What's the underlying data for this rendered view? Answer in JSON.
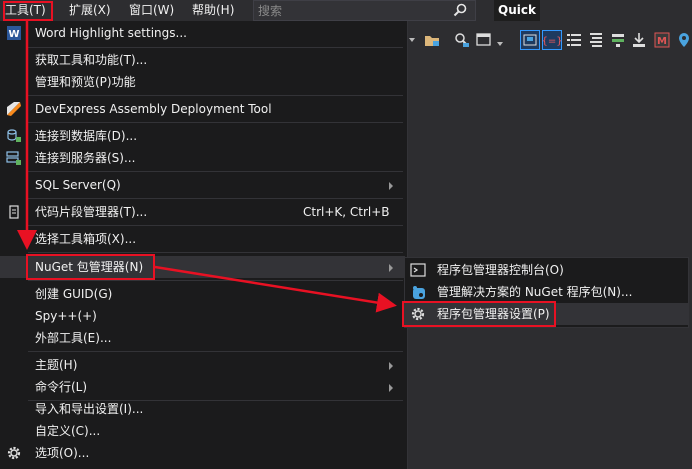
{
  "menubar": {
    "items": [
      "工具(T)",
      "扩展(X)",
      "窗口(W)",
      "帮助(H)"
    ],
    "search_placeholder": "搜索",
    "quick_label": "Quick"
  },
  "tools_menu": {
    "items": [
      {
        "label": "Word Highlight settings...",
        "icon": "word-highlight-icon"
      },
      {
        "label": "获取工具和功能(T)..."
      },
      {
        "label": "管理和预览(P)功能"
      },
      {
        "label": "DevExpress Assembly Deployment Tool",
        "icon": "devexpress-icon"
      },
      {
        "label": "连接到数据库(D)...",
        "icon": "database-connect-icon"
      },
      {
        "label": "连接到服务器(S)...",
        "icon": "server-connect-icon"
      },
      {
        "label": "SQL Server(Q)",
        "submenu": true
      },
      {
        "label": "代码片段管理器(T)...",
        "shortcut": "Ctrl+K, Ctrl+B",
        "icon": "snippet-icon"
      },
      {
        "label": "选择工具箱项(X)..."
      },
      {
        "label": "NuGet 包管理器(N)",
        "submenu": true
      },
      {
        "label": "创建 GUID(G)"
      },
      {
        "label": "Spy++(+)"
      },
      {
        "label": "外部工具(E)..."
      },
      {
        "label": "主题(H)",
        "submenu": true
      },
      {
        "label": "命令行(L)",
        "submenu": true
      },
      {
        "label": "导入和导出设置(I)..."
      },
      {
        "label": "自定义(C)..."
      },
      {
        "label": "选项(O)...",
        "icon": "gear-icon"
      }
    ]
  },
  "nuget_submenu": {
    "items": [
      {
        "label": "程序包管理器控制台(O)",
        "icon": "console-icon"
      },
      {
        "label": "管理解决方案的 NuGet 程序包(N)...",
        "icon": "nuget-icon"
      },
      {
        "label": "程序包管理器设置(P)",
        "icon": "gear-icon"
      }
    ]
  },
  "colors": {
    "accent": "#e81123",
    "menu_bg": "#1b1b1c",
    "highlight": "#333337"
  }
}
